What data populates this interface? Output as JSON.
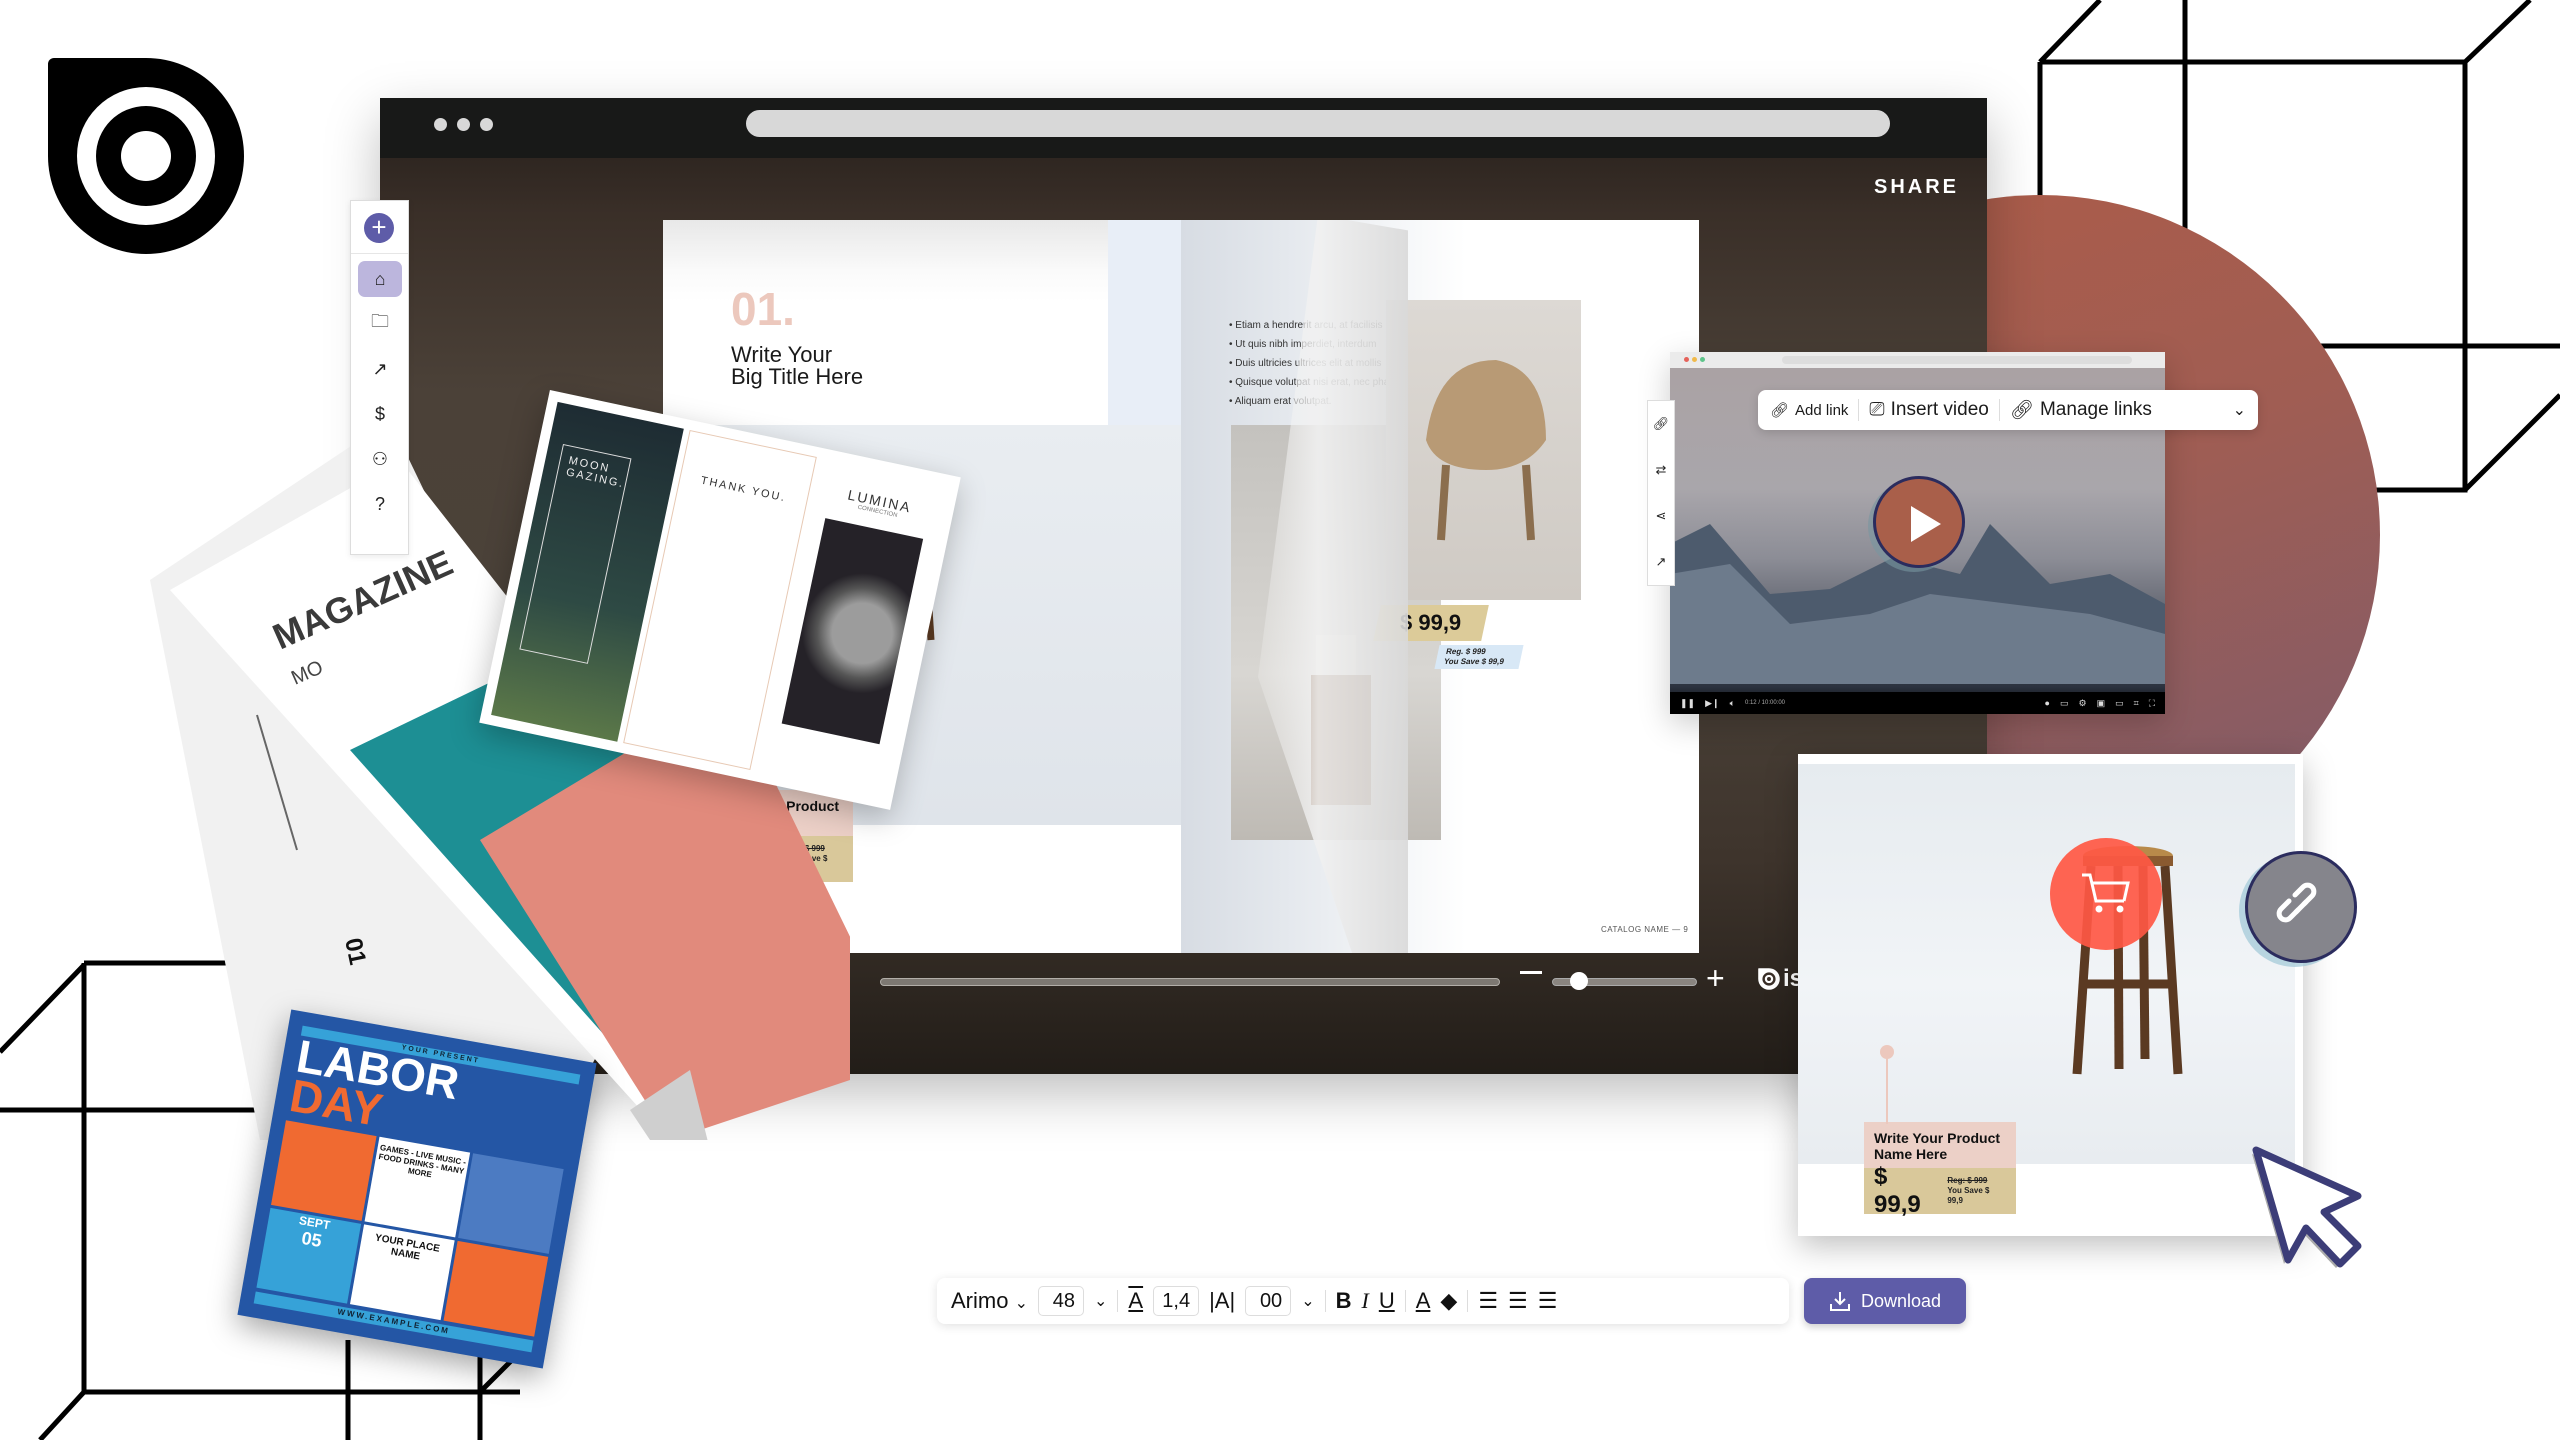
{
  "brand": {
    "logo_icon": "issuu-target-logo"
  },
  "viewer": {
    "share_label": "SHARE",
    "window_dots": 3,
    "zoom_level": 0.15,
    "page_progress": 0.95,
    "brand_text": "is"
  },
  "sidebar": {
    "add_icon": "plus-icon",
    "items": [
      {
        "name": "home",
        "icon": "home-icon",
        "glyph": "⌂",
        "active": true
      },
      {
        "name": "folder",
        "icon": "folder-icon",
        "glyph": "🗀",
        "active": false
      },
      {
        "name": "statistics",
        "icon": "trend-icon",
        "glyph": "↗",
        "active": false
      },
      {
        "name": "monetize",
        "icon": "dollar-icon",
        "glyph": "$",
        "active": false
      },
      {
        "name": "account",
        "icon": "user-icon",
        "glyph": "⚇",
        "active": false
      },
      {
        "name": "help",
        "icon": "help-icon",
        "glyph": "?",
        "active": false
      }
    ]
  },
  "catalog": {
    "number": "01.",
    "title_line1": "Write Your",
    "title_line2": "Big Title Here",
    "bullets": [
      "Etiam a hendrerit arcu, at facilisis",
      "Ut quis nibh imperdiet, interdum",
      "Duis ultricies ultrices elit at mollis",
      "Quisque volutpat nisi erat, nec pharetra",
      "Aliquam erat volutpat."
    ],
    "product_tag": {
      "name": "Write Your Product Name Here",
      "price": "$ 99,9",
      "regular": "Reg. $ 999",
      "savings": "You Save $ 99,9"
    },
    "price_badge": "$ 99,9",
    "reg_line1": "Reg. $ 999",
    "reg_line2": "You Save $ 99,9",
    "footer": "CATALOG NAME — 9"
  },
  "magazine": {
    "title": "MAGAZINE",
    "subtitle": "MO",
    "issue": "01"
  },
  "trifold": {
    "panel1_title": "MOON GAZING.",
    "panel2_title": "THANK YOU.",
    "panel3_title": "LUMINA",
    "panel3_sub": "CONNECTION"
  },
  "labor_flyer": {
    "present": "YOUR PRESENT",
    "title1": "LABOR",
    "title2": "DAY",
    "activities": "GAMES - LIVE MUSIC - FOOD DRINKS - MANY MORE",
    "month": "SEPT",
    "day": "05",
    "place": "YOUR PLACE NAME",
    "url": "WWW.EXAMPLE.COM"
  },
  "video_panel": {
    "link_toolbar": {
      "add_link": "Add link",
      "insert_video": "Insert video",
      "manage_links": "Manage links"
    },
    "tools": [
      "link-icon",
      "loop-icon",
      "share-icon",
      "trend-icon"
    ],
    "time": "0:12 / 10:00:00",
    "dot_colors": [
      "#e5625a",
      "#f0b94a",
      "#5ec48a"
    ]
  },
  "product_card": {
    "name": "Write Your Product Name Here",
    "price": "$ 99,9",
    "regular": "Reg: $ 999",
    "savings": "You Save $ 99,9"
  },
  "text_toolbar": {
    "font": "Arimo",
    "size": "48",
    "line_height": "1,4",
    "letter_spacing": "00",
    "download_label": "Download"
  },
  "colors": {
    "accent": "#5e5ca8",
    "accent_light": "#bcb6dd",
    "circle": "#ad5c48",
    "cart": "#ff5844",
    "tag_pink": "#ecd0c7",
    "tag_gold": "#d9c89a"
  }
}
